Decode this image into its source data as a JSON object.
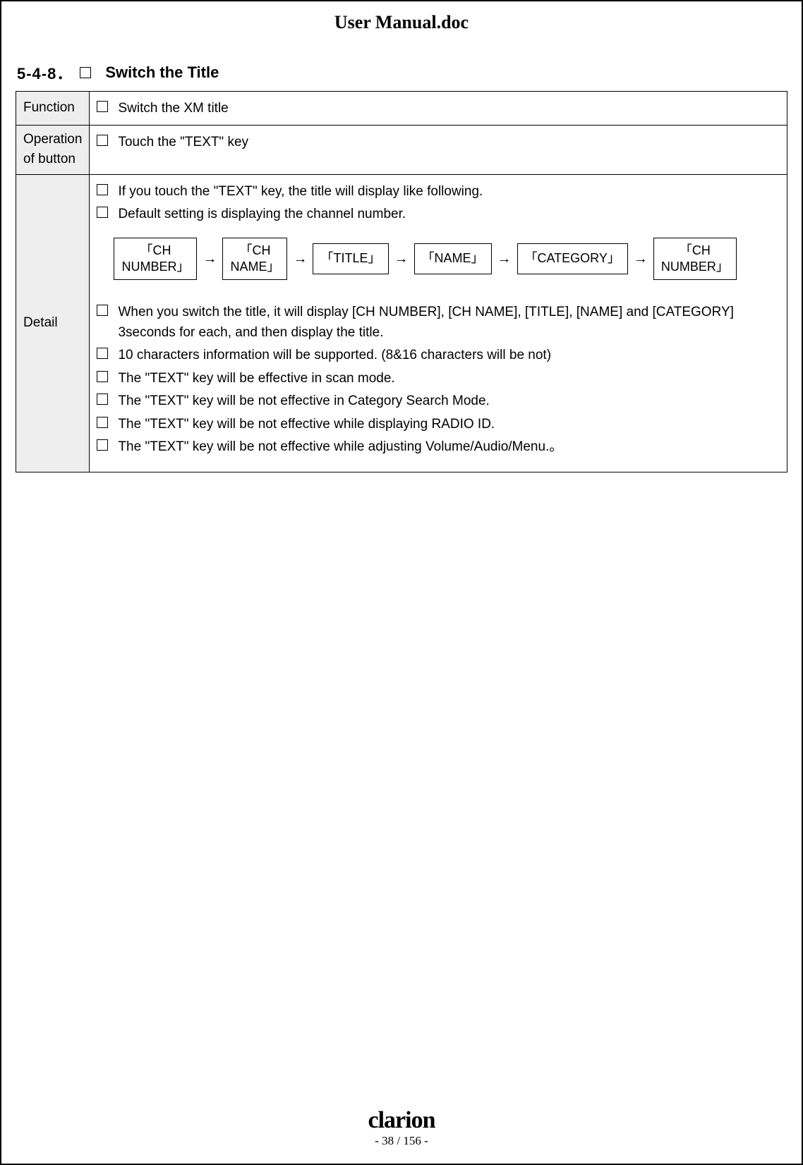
{
  "doc_title": "User Manual.doc",
  "section": {
    "number": "5-4-8．",
    "title": "Switch the Title"
  },
  "rows": {
    "function": {
      "label": "Function",
      "text": "Switch the XM title"
    },
    "operation": {
      "label": "Operation of button",
      "text": "Touch the \"TEXT\" key"
    },
    "detail": {
      "label": "Detail",
      "intro": [
        "If you touch the \"TEXT\" key, the title will display like following.",
        "Default setting is displaying the channel number."
      ],
      "flow": [
        "「CH\nNUMBER」",
        "「CH\nNAME」",
        "「TITLE」",
        "「NAME」",
        "「CATEGORY」",
        "「CH\nNUMBER」"
      ],
      "arrow": "→",
      "bullets": [
        "When you switch the title, it will display [CH NUMBER], [CH NAME], [TITLE], [NAME] and [CATEGORY] 3seconds for each, and then display the title.",
        "10 characters information will be supported. (8&16 characters will be not)",
        "The \"TEXT\" key will be effective in scan mode.",
        "The \"TEXT\" key will be not effective in Category Search Mode.",
        "The \"TEXT\" key will be not effective while displaying RADIO ID.",
        "The \"TEXT\" key will be not effective while adjusting Volume/Audio/Menu.。"
      ]
    }
  },
  "footer": {
    "brand": "clarion",
    "page": "- 38 / 156 -"
  }
}
